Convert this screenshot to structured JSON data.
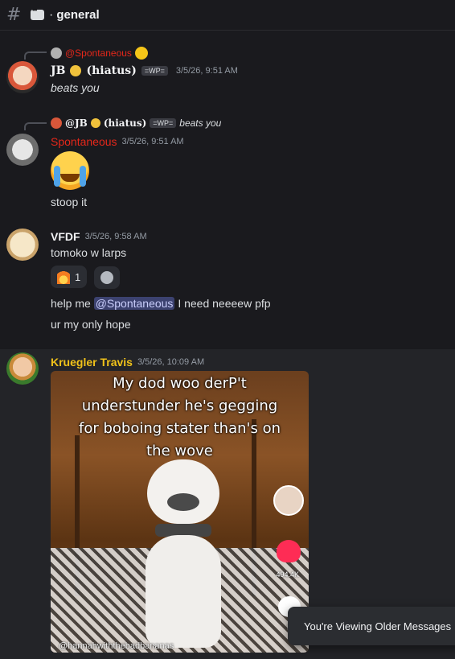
{
  "header": {
    "hash": "#",
    "dot": "·",
    "channel": "general"
  },
  "messages": [
    {
      "reply_to": "@Spontaneous",
      "author": "JB",
      "author_suffix": "(hiatus)",
      "tag": "=WP=",
      "timestamp": "3/5/26, 9:51 AM",
      "text": "beats you"
    },
    {
      "reply_to_author": "@JB",
      "reply_to_suffix": "(hiatus)",
      "reply_to_tag": "=WP=",
      "reply_to_text": "beats you",
      "author": "Spontaneous",
      "timestamp": "3/5/26, 9:51 AM",
      "text": "stoop it"
    },
    {
      "author": "VFDF",
      "timestamp": "3/5/26, 9:58 AM",
      "text": "tomoko w larps",
      "reaction_count": "1",
      "text2_before": "help me ",
      "mention": "@Spontaneous",
      "text2_after": " I need neeeew pfp",
      "text3": "ur my only hope"
    },
    {
      "author": "Kruegler Travis",
      "timestamp": "3/5/26, 10:09 AM",
      "image_caption": "My dod woo derP't understunder he's gegging for boboing stater than's on the wove",
      "image_likes": "494.4K",
      "image_side_count": "5",
      "image_watermark": "@hannahwiththebadbananas"
    }
  ],
  "toast": "You're Viewing Older Messages",
  "colors": {
    "background": "#1a1a1e",
    "spontaneous": "#e5271a",
    "kruegler": "#f0c21a",
    "default_name": "#f2f3f5",
    "mention_bg": "#3c4270"
  }
}
